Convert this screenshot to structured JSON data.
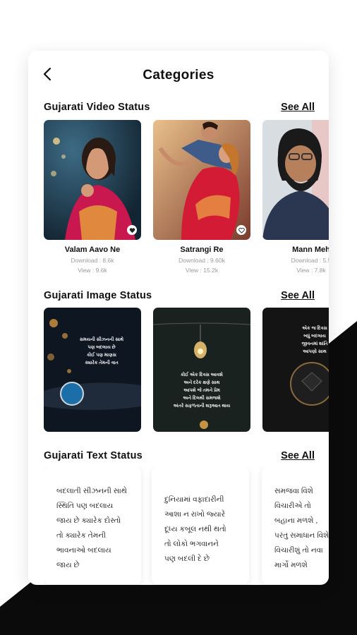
{
  "header": {
    "title": "Categories"
  },
  "sections": {
    "video": {
      "title": "Gujarati Video Status",
      "see_all": "See All",
      "items": [
        {
          "name": "Valam Aavo Ne",
          "download": "Download :  8.6k",
          "view": "View :  9.6k"
        },
        {
          "name": "Satrangi Re",
          "download": "Download :  9.60k",
          "view": "View :  15.2k"
        },
        {
          "name": "Mann Meh",
          "download": "Download :  5.5",
          "view": "View :  7.8k"
        }
      ]
    },
    "image": {
      "title": "Gujarati Image Status",
      "see_all": "See All",
      "items": [
        {
          "text": "સમયની સીઝનની સાથે\nપણ બદલાય છે\nકોઈ પણ માણસ\nક્યારેક તેમની વાત"
        },
        {
          "text": "કોઈ એક દિવસ આવશે\nઅને દરેક ક્ષણે સાથ\nઆપશે જે તમને પ્રેમ\nઅને દિલથી સમજશે\nઅંતરે સફળતાની શરૂઆત થાય"
        },
        {
          "text": "એક જ દિવસ\nબધું બદલાય\nજીવનમાં શાંતિ\nઆપણો સાથ"
        }
      ]
    },
    "text": {
      "title": "Gujarati Text Status",
      "see_all": "See All",
      "items": [
        {
          "text": "બદલાતી સીઝનની સાથે\nસ્થિતિ પણ બદલાય\nજાય છે ક્યારેક દોસ્તો\nતો ક્યારેક તેમની\nભાવનાઓ બદલાય\nજાય છે"
        },
        {
          "text": "દુનિયામાં વફાદારીની\nઆશા ન રાખો જ્યારે\nદૂધ્ય કબૂલ નથી થતો\nતો લોકો ભગવાનને\nપણ બદલી દે છે"
        },
        {
          "text": "સમજવા વિશે\nવિચારીએ તો\nબહાના મળશે ,\nપરંતુ સમાધાન વિશે\nવિચારીશું તો નવા\nમાર્ગો મળશે"
        }
      ]
    }
  },
  "colors": {
    "background_dark": "#0b0b0b",
    "accent_text": "#111111"
  }
}
